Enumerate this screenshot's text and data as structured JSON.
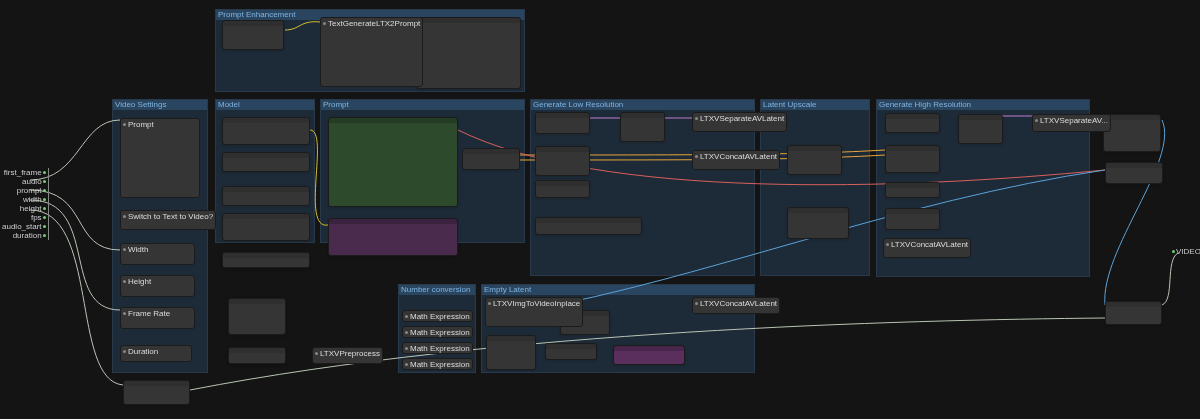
{
  "groups": [
    {
      "title": "Prompt Enhancement"
    },
    {
      "title": "Video Settings"
    },
    {
      "title": "Model"
    },
    {
      "title": "Prompt"
    },
    {
      "title": "Generate Low Resolution"
    },
    {
      "title": "Latent Upscale"
    },
    {
      "title": "Generate High Resolution"
    },
    {
      "title": "Number conversion"
    },
    {
      "title": "Empty Latent"
    }
  ],
  "nodes": [
    {
      "title": "TextGenerateLTX2Prompt"
    },
    {
      "title": "Prompt"
    },
    {
      "title": "Switch to Text to Video?"
    },
    {
      "title": "Width"
    },
    {
      "title": "Height"
    },
    {
      "title": "Frame Rate"
    },
    {
      "title": "Duration"
    },
    {
      "title": "LTXVSeparateAVLatent"
    },
    {
      "title": "LTXVConcatAVLatent"
    },
    {
      "title": "LTXVSeparateAV..."
    },
    {
      "title": "LTXVConcatAVLatent"
    },
    {
      "title": "LTXVImgToVideoInplace"
    },
    {
      "title": "LTXVConcatAVLatent"
    },
    {
      "title": "LTXVPreprocess"
    },
    {
      "title": "Math Expression"
    },
    {
      "title": "Math Expression"
    },
    {
      "title": "Math Expression"
    },
    {
      "title": "Math Expression"
    }
  ],
  "graph_inputs": [
    "first_frame",
    "audio",
    "prompt",
    "width",
    "height",
    "fps",
    "audio_start",
    "duration"
  ],
  "output_label": "VIDEO"
}
